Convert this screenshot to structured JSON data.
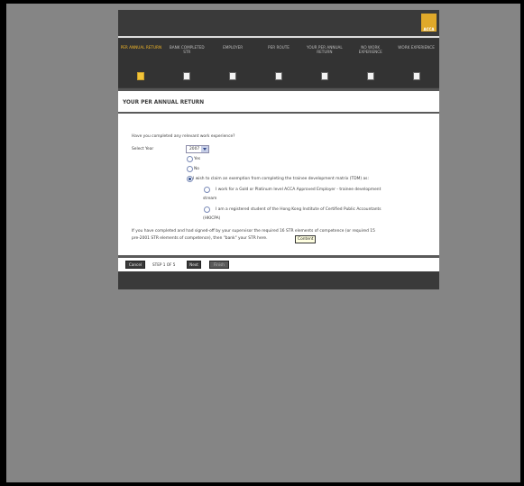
{
  "header": {
    "logo_text": "ACCA"
  },
  "steps": [
    {
      "label": "PER ANNUAL RETURN",
      "active": true
    },
    {
      "label": "BANK COMPLETED STR",
      "active": false
    },
    {
      "label": "EMPLOYER",
      "active": false
    },
    {
      "label": "PER ROUTE",
      "active": false
    },
    {
      "label": "YOUR PER ANNUAL RETURN",
      "active": false
    },
    {
      "label": "NO WORK EXPERIENCE",
      "active": false
    },
    {
      "label": "WORK EXPERIENCE",
      "active": false
    }
  ],
  "form": {
    "section_title": "YOUR PER ANNUAL RETURN",
    "question": "Have you completed any relevant work experience?",
    "select_year_label": "Select Year",
    "year_value": "2007",
    "options": {
      "yes": "Yes",
      "no": "No",
      "exempt": "I wish to claim an exemption from completing the trainee development matrix (TDM) as:",
      "gold": "I work for a Gold or Platinum level ACCA Approved Employer - trainee development",
      "gold_2": "stream",
      "hkicpa": "I am a registered student of the Hong Kong Institute of Certified Public Accountants",
      "hkicpa_2": "(HKICPA)"
    },
    "footnote_1": "If you have completed and had signed-off by your supervisor the required 16 STR elements of competence (or required 15",
    "footnote_2": "pre-2001 STR elements of competence), then \"bank\" your STR here.",
    "tooltip": "Content"
  },
  "footer": {
    "cancel_label": "Cancel",
    "step_indicator": "STEP 1 OF 5",
    "next_label": "Next",
    "finish_label": "Finish"
  },
  "colors": {
    "accent": "#f0b528",
    "dark": "#3a3a3a",
    "backdrop": "#858585"
  }
}
